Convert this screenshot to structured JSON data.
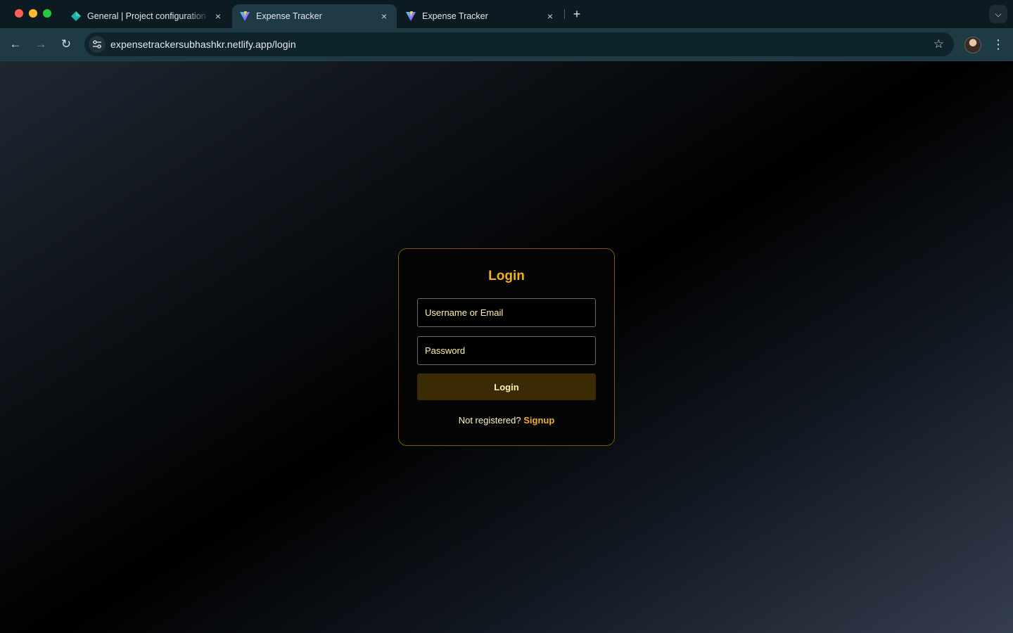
{
  "browser": {
    "tabs": [
      {
        "title": "General | Project configuration",
        "close_label": "×",
        "active": false,
        "favicon": "diamond-favicon"
      },
      {
        "title": "Expense Tracker",
        "close_label": "×",
        "active": true,
        "favicon": "vite-favicon"
      },
      {
        "title": "Expense Tracker",
        "close_label": "×",
        "active": false,
        "favicon": "vite-favicon"
      }
    ],
    "new_tab_label": "+",
    "url": "expensetrackersubhashkr.netlify.app/login",
    "icons": {
      "back": "arrow-left-icon",
      "forward": "arrow-right-icon",
      "reload": "reload-icon",
      "site_info": "tune-icon",
      "bookmark": "star-icon",
      "menu": "more-vert-icon",
      "tab_search": "chevron-down-icon"
    }
  },
  "login": {
    "heading": "Login",
    "username_placeholder": "Username or Email",
    "password_placeholder": "Password",
    "submit_label": "Login",
    "prompt_text": "Not registered?",
    "signup_link": "Signup"
  },
  "colors": {
    "accent": "#f0b020",
    "card_border": "#7a5a10",
    "button_bg": "#3a2b05",
    "input_text": "#fff4a8"
  }
}
